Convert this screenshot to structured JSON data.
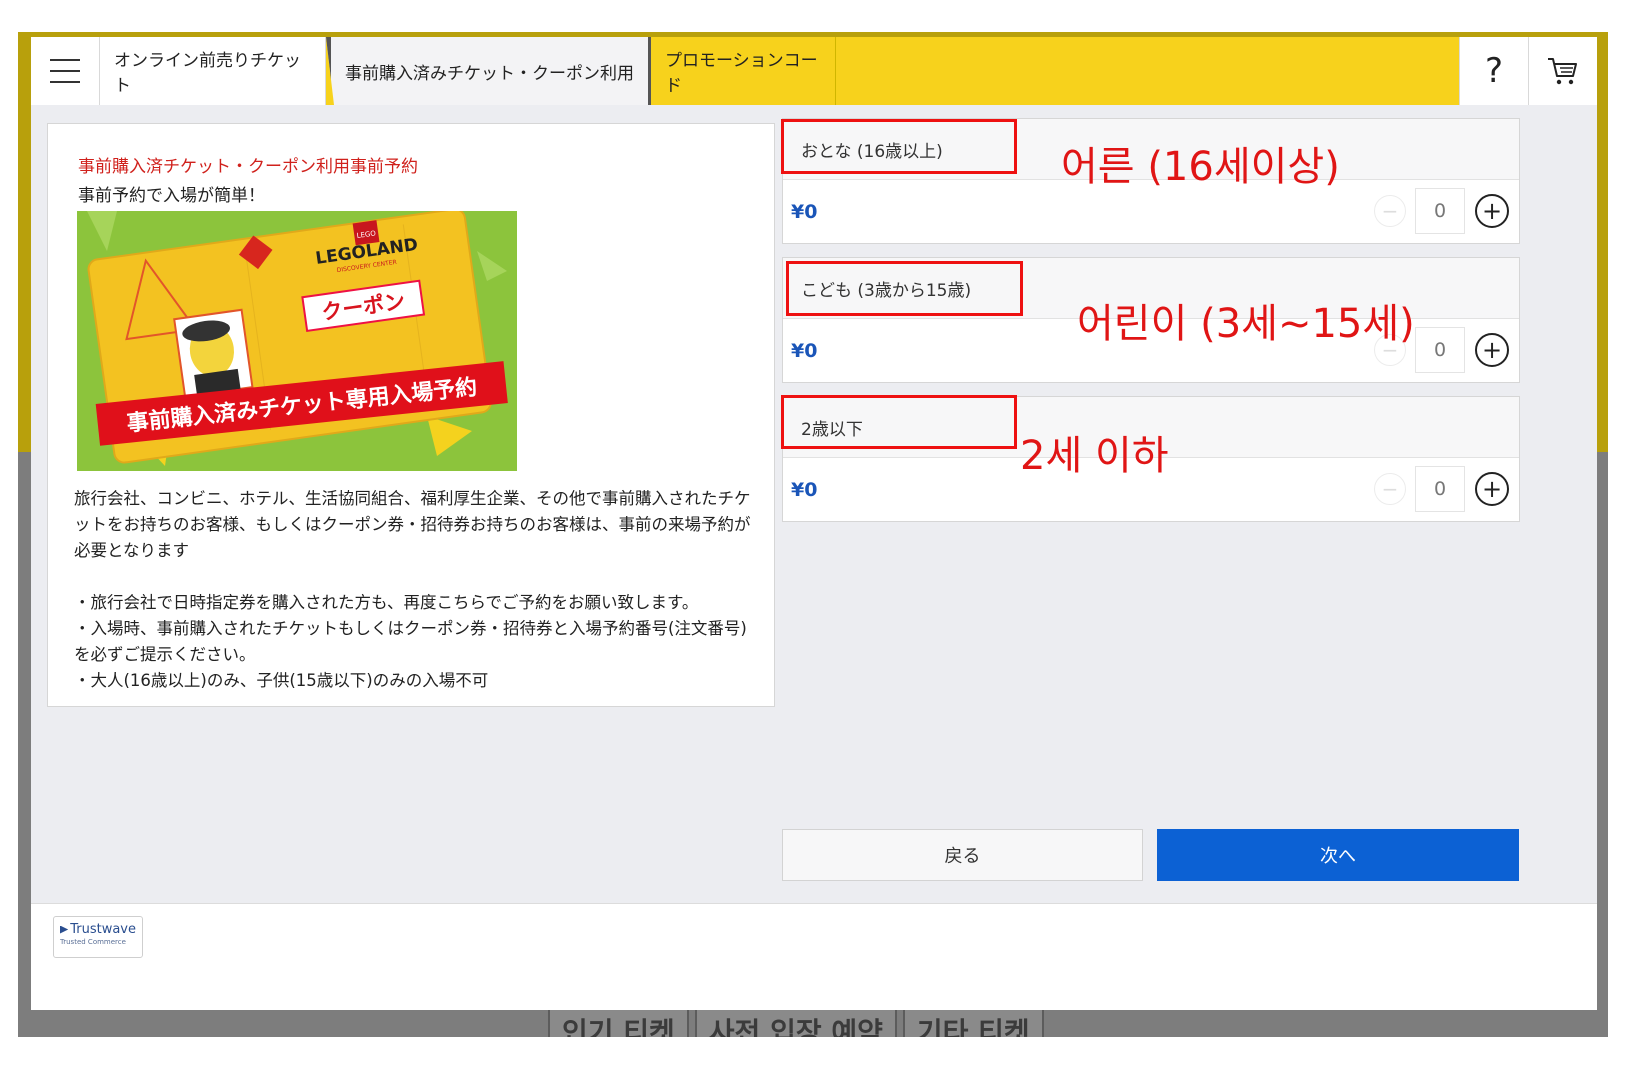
{
  "background": {
    "bottom_tabs": [
      "인기 티켓",
      "사전 입장 예약",
      "기타 티켓"
    ]
  },
  "header": {
    "tabs": [
      {
        "label": "オンライン前売りチケット"
      },
      {
        "label": "事前購入済みチケット・クーポン利用"
      },
      {
        "label": "プロモーションコード"
      }
    ],
    "help_label": "?"
  },
  "info": {
    "title": "事前購入済チケット・クーポン利用事前予約",
    "subtitle": "事前予約で入場が簡単！",
    "image": {
      "brand": "LEGOLAND",
      "brand_sub": "DISCOVERY CENTER",
      "lego_logo": "LEGO",
      "coupon_label": "クーポン",
      "banner": "事前購入済みチケット専用入場予約"
    },
    "paragraph": "旅行会社、コンビニ、ホテル、生活協同組合、福利厚生企業、その他で事前購入されたチケットをお持ちのお客様、もしくはクーポン券・招待券お持ちのお客様は、事前の来場予約が必要となります",
    "notes": [
      "・旅行会社で日時指定券を購入された方も、再度こちらでご予約をお願い致します。",
      "・入場時、事前購入されたチケットもしくはクーポン券・招待券と入場予約番号(注文番号)を必ずご提示ください。",
      "・大人(16歳以上)のみ、子供(15歳以下)のみの入場不可"
    ]
  },
  "tickets": [
    {
      "label": "おとな (16歳以上)",
      "price": "¥0",
      "quantity": "0",
      "annotation": "어른 (16세이상)"
    },
    {
      "label": "こども (3歳から15歳)",
      "price": "¥0",
      "quantity": "0",
      "annotation": "어린이 (3세~15세)"
    },
    {
      "label": "2歳以下",
      "price": "¥0",
      "quantity": "0",
      "annotation": "2세 이하"
    }
  ],
  "actions": {
    "back_label": "戻る",
    "next_label": "次へ"
  },
  "footer": {
    "badge_name": "Trustwave",
    "badge_sub": "Trusted Commerce"
  },
  "colors": {
    "brand_yellow": "#f7d21c",
    "primary_blue": "#0c61d4",
    "price_blue": "#1a55b8",
    "title_red": "#d0211c",
    "annotation_red": "#e01515"
  }
}
